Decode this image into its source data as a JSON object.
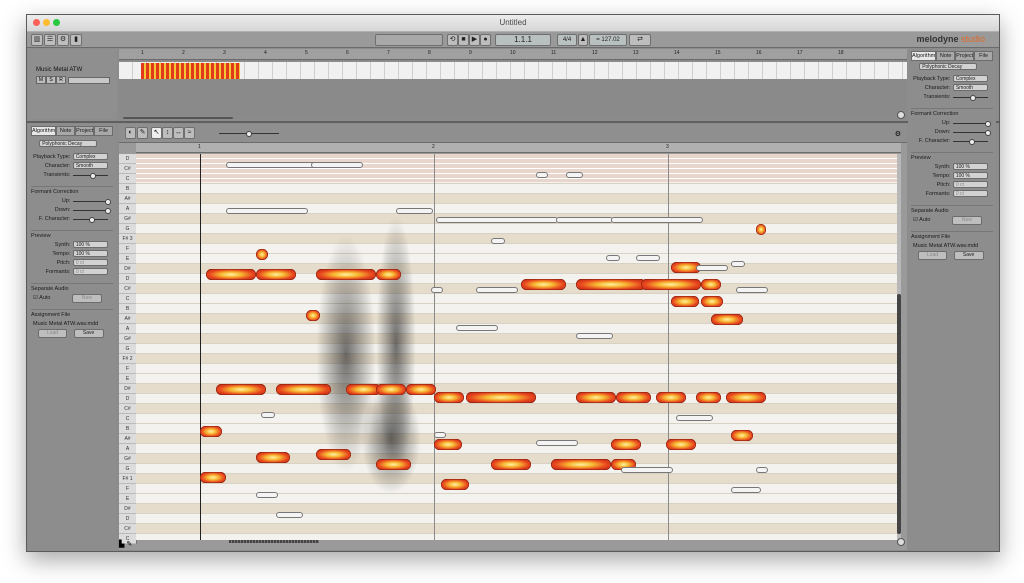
{
  "window": {
    "title": "Untitled"
  },
  "toolbar": {
    "position": "1.1.1",
    "meter": "4/4",
    "tempo": "= 127.02",
    "brand": "melodyne",
    "brand_edition": "studio"
  },
  "track": {
    "name": "Music Metal ATW",
    "m": "M",
    "s": "S",
    "r": "R"
  },
  "ruler": {
    "bars": [
      "1",
      "2",
      "3",
      "4",
      "5",
      "6",
      "7",
      "8",
      "9",
      "10",
      "11",
      "12",
      "13",
      "14",
      "15",
      "16",
      "17",
      "18"
    ]
  },
  "editor_ruler": {
    "bars": [
      "1",
      "2",
      "3"
    ]
  },
  "left_inspector": {
    "tabs": [
      "Algorithm",
      "Note",
      "Project",
      "File"
    ],
    "algorithm": "Polyphonic Decay",
    "playback_type_label": "Playback Type:",
    "playback_type": "Complex",
    "character_label": "Character:",
    "character": "Smooth",
    "transients_label": "Transients:",
    "formant_heading": "Formant Correction",
    "up_label": "Up:",
    "down_label": "Down:",
    "fcharacter_label": "F. Character:",
    "preview_heading": "Preview",
    "synth_label": "Synth:",
    "synth": "100 %",
    "tempo_label": "Tempo:",
    "tempo": "100 %",
    "pitch_label": "Pitch:",
    "pitch": "0 ct",
    "formants_label": "Formants:",
    "formants": "0 ct",
    "separate_heading": "Separate Audio",
    "auto_label": "Auto",
    "now_label": "Now",
    "assign_heading": "Assignment File",
    "assign_file": "Music Metal ATW.wav.mdd",
    "load_label": "Load",
    "save_label": "Save"
  },
  "right_inspector": {
    "tabs": [
      "Algorithm",
      "Note",
      "Project",
      "File"
    ],
    "algorithm": "Polyphonic Decay",
    "playback_type_label": "Playback Type:",
    "playback_type": "Complex",
    "character_label": "Character:",
    "character": "Smooth",
    "transients_label": "Transients:",
    "formant_heading": "Formant Correction",
    "up_label": "Up:",
    "down_label": "Down:",
    "fcharacter_label": "F. Character:",
    "preview_heading": "Preview",
    "synth_label": "Synth:",
    "synth": "100 %",
    "tempo_label": "Tempo:",
    "tempo": "100 %",
    "pitch_label": "Pitch:",
    "pitch": "0 ct",
    "formants_label": "Formants:",
    "formants": "0 ct",
    "separate_heading": "Separate Audio",
    "auto_label": "Auto",
    "now_label": "Now",
    "assign_heading": "Assignment File",
    "assign_file": "Music Metal ATW.wav.mdd",
    "load_label": "Load",
    "save_label": "Save"
  },
  "keys": [
    "D",
    "C#",
    "C",
    "B",
    "A#",
    "A",
    "G#",
    "G",
    "F# 3",
    "F",
    "E",
    "D#",
    "D",
    "C#",
    "C",
    "B",
    "A#",
    "A",
    "G#",
    "G",
    "F# 2",
    "F",
    "E",
    "D#",
    "D",
    "C#",
    "C",
    "B",
    "A#",
    "A",
    "G#",
    "G",
    "F# 1",
    "F",
    "E",
    "D#",
    "D",
    "C#",
    "C"
  ],
  "colors": {
    "blob_core": "#f7b731",
    "blob_edge": "#e8471e",
    "window_gray": "#8c8c8c"
  }
}
